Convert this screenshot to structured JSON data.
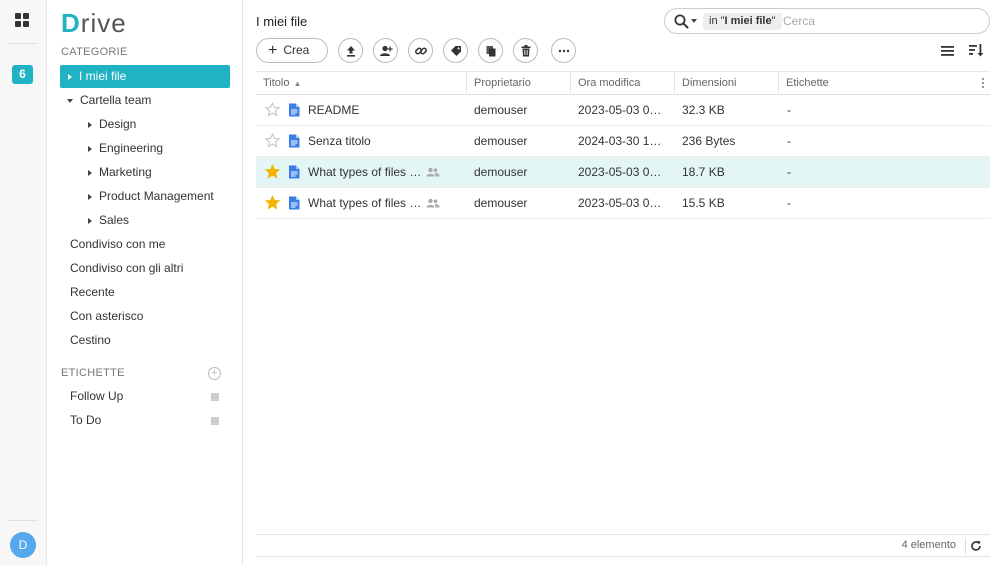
{
  "rail": {
    "badge": "6",
    "avatar": "D"
  },
  "sidebar": {
    "logo": {
      "first": "D",
      "rest": "rive"
    },
    "categories_title": "CATEGORIE",
    "items": [
      {
        "label": "I miei file",
        "active": true
      },
      {
        "label": "Cartella team"
      },
      {
        "label": "Design"
      },
      {
        "label": "Engineering"
      },
      {
        "label": "Marketing"
      },
      {
        "label": "Product Management"
      },
      {
        "label": "Sales"
      },
      {
        "label": "Condiviso con me"
      },
      {
        "label": "Condiviso con gli altri"
      },
      {
        "label": "Recente"
      },
      {
        "label": "Con asterisco"
      },
      {
        "label": "Cestino"
      }
    ],
    "tags_title": "ETICHETTE",
    "tags": [
      {
        "label": "Follow Up"
      },
      {
        "label": "To Do"
      }
    ]
  },
  "header": {
    "breadcrumb": "I miei file",
    "search": {
      "scope_prefix": "in \"",
      "scope_name": "I miei file",
      "scope_suffix": "\"",
      "placeholder": "Cerca"
    }
  },
  "toolbar": {
    "create_label": "Crea",
    "actions": [
      "upload-icon",
      "share-user-icon",
      "link-icon",
      "tag-icon",
      "copy-icon",
      "trash-icon",
      "more-icon"
    ]
  },
  "table": {
    "columns": [
      "Titolo",
      "Proprietario",
      "Ora modifica",
      "Dimensioni",
      "Etichette"
    ],
    "rows": [
      {
        "title": "README",
        "owner": "demouser",
        "modified": "2023-05-03 0…",
        "size": "32.3 KB",
        "tags": "-",
        "starred": false,
        "shared": false,
        "selected": false
      },
      {
        "title": "Senza titolo",
        "owner": "demouser",
        "modified": "2024-03-30 1…",
        "size": "236 Bytes",
        "tags": "-",
        "starred": false,
        "shared": false,
        "selected": false
      },
      {
        "title": "What types of files …",
        "owner": "demouser",
        "modified": "2023-05-03 0…",
        "size": "18.7 KB",
        "tags": "-",
        "starred": true,
        "shared": true,
        "selected": true
      },
      {
        "title": "What types of files …",
        "owner": "demouser",
        "modified": "2023-05-03 0…",
        "size": "15.5 KB",
        "tags": "-",
        "starred": true,
        "shared": true,
        "selected": false
      }
    ]
  },
  "footer": {
    "count": "4 elemento"
  },
  "colors": {
    "accent": "#1fb3c3",
    "star_on": "#f5b400",
    "doc_blue": "#3a7ee6",
    "selected_row": "#e4f5f6"
  }
}
